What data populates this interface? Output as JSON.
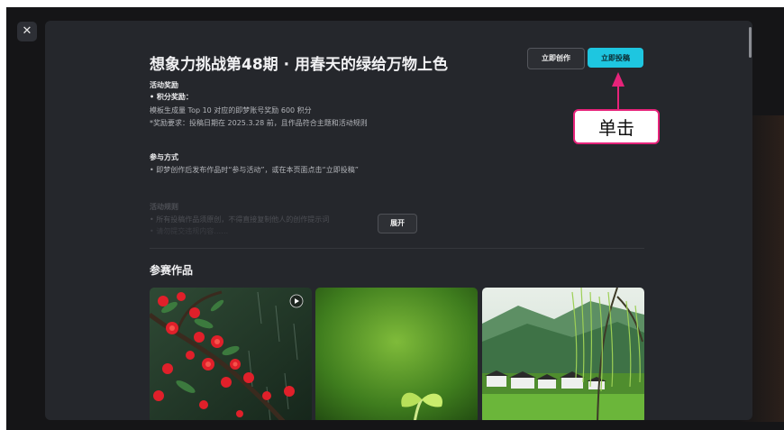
{
  "close_icon": "close-icon",
  "title": "想象力挑战第48期 · 用春天的绿给万物上色",
  "actions": {
    "create_label": "立即创作",
    "submit_label": "立即投稿"
  },
  "rewards": {
    "heading": "活动奖励",
    "subheading": "• 积分奖励：",
    "line1": "模板生成量 Top 10 对应的即梦账号奖励 600 积分",
    "line2": "*奖励要求：投稿日期在 2025.3.28 前，且作品符合主题和活动规则"
  },
  "participate": {
    "heading": "参与方式",
    "line1": "• 即梦创作后发布作品时“参与活动”，或在本页面点击“立即投稿”"
  },
  "rules": {
    "heading": "活动规则",
    "line1": "• 所有投稿作品须原创，不得直接复制他人的创作提示词",
    "line2": "• 请勿提交违规内容……",
    "expand_label": "展开"
  },
  "works": {
    "heading": "参赛作品",
    "items": [
      {
        "name": "red-blossoms-in-rain",
        "play_icon": "play-icon"
      },
      {
        "name": "green-sprout"
      },
      {
        "name": "village-with-willows"
      }
    ]
  },
  "annotation": {
    "label": "单击",
    "color": "#e6237a"
  },
  "colors": {
    "accent": "#1ec6e0",
    "panel": "#25272c",
    "background": "#151517"
  }
}
